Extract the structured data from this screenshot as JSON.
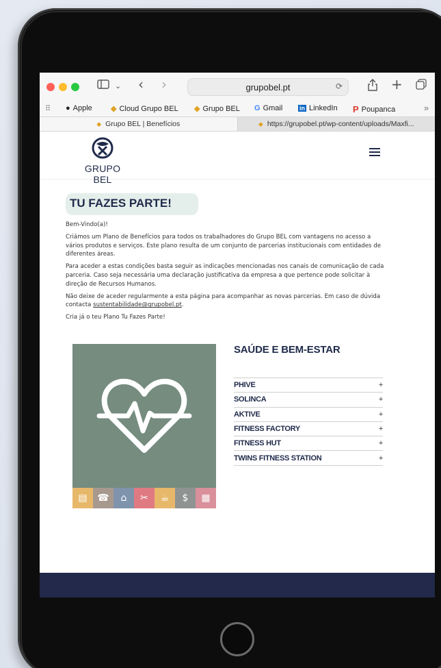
{
  "browser": {
    "url": "grupobel.pt",
    "bookmarks": [
      "Apple",
      "Cloud Grupo BEL",
      "Grupo BEL",
      "Gmail",
      "LinkedIn",
      "Poupanca"
    ],
    "tabs": [
      {
        "title": "Grupo BEL | Benefícios",
        "active": true
      },
      {
        "title": "https://grupobel.pt/wp-content/uploads/Maxfi...",
        "active": false
      }
    ]
  },
  "site": {
    "logo_text": "GRUPO BEL",
    "hero_title": "TU FAZES PARTE!",
    "intro": {
      "greeting": "Bem-Vindo(a)!",
      "p1": "Criámos um Plano de Benefícios para todos os trabalhadores do Grupo BEL com vantagens no acesso a vários produtos e serviços. Este plano resulta de um conjunto de parcerias institucionais com entidades de diferentes áreas.",
      "p2": "Para aceder a estas condições basta seguir as indicações mencionadas nos canais de comunicação de cada parceria. Caso seja necessária uma declaração justificativa da empresa a que pertence pode solicitar à direção de Recursos Humanos.",
      "p3_before": "Não deixe de aceder regularmente a esta página para acompanhar as novas parcerias. Em caso de dúvida contacta ",
      "p3_link": "sustentabilidade@grupobel.pt",
      "p3_after": ".",
      "p4": "Cria já o teu Plano Tu Fazes Parte!"
    },
    "section_title": "SAÚDE E BEM-ESTAR",
    "partners": [
      "PHIVE",
      "SOLINCA",
      "AKTIVE",
      "FITNESS FACTORY",
      "FITNESS HUT",
      "TWINS FITNESS STATION"
    ],
    "expand_symbol": "+",
    "colors": {
      "navy": "#1f2a4a",
      "card_green": "#758c7f",
      "hero_bg": "#e4efeb",
      "strip": [
        "#e8b86a",
        "#a8998e",
        "#7f93ad",
        "#e07a82",
        "#e8b86a",
        "#8f9493",
        "#d9909a"
      ]
    }
  }
}
